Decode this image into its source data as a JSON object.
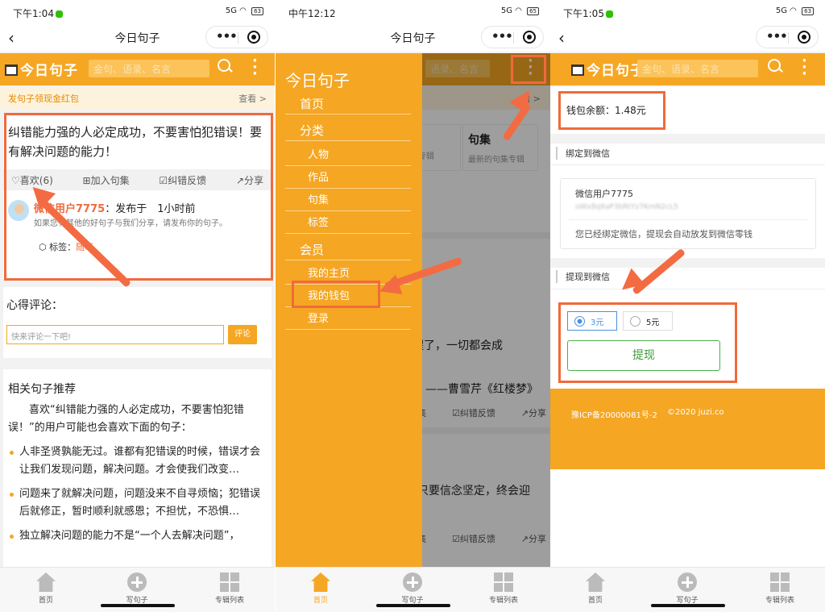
{
  "status": {
    "p1_time": "下午1:04",
    "p2_time": "中午12:12",
    "p3_time": "下午1:05",
    "signal": "5G",
    "p1_battery": "63",
    "p2_battery": "65",
    "p3_battery": "63"
  },
  "app": {
    "title": "今日句子",
    "logo": "今日句子",
    "search_placeholder": "金句、语录、名言",
    "brand_color": "#f5a623",
    "annotation_color": "#f06a3c"
  },
  "p1": {
    "promo": "发句子领现金红包",
    "promo_more": "查看 >",
    "sentence": "纠错能力强的人必定成功，不要害怕犯错误！要有解决问题的能力！",
    "actions": [
      "♡喜欢(6)",
      "⊞加入句集",
      "☑纠错反馈",
      "↗分享"
    ],
    "author_name": "微信用户7775",
    "posted": "：发布于　1小时前",
    "invite": "如果您有其他的好句子与我们分享，请发布你的句子。",
    "tag_label": "标签：",
    "tag_value": "随笔",
    "comment_title": "心得评论：",
    "comment_placeholder": "快来评论一下吧!",
    "comment_button": "评论",
    "related_title": "相关句子推荐",
    "related_intro": "　　喜欢“纠错能力强的人必定成功，不要害怕犯错误！”的用户可能也会喜欢下面的句子：",
    "related": [
      "人非圣贤孰能无过。谁都有犯错误的时候，错误才会让我们发现问题，解决问题。才会使我们改变…",
      "问题来了就解决问题，问题没来不自寻烦恼；犯错误后就修正，暂时顺利就感恩；不担忧，不恐惧…",
      "独立解决问题的能力不是“一个人去解决问题”，"
    ]
  },
  "p2": {
    "drawer_title": "今日句子",
    "menu": [
      {
        "label": "首页",
        "kind": "sec"
      },
      {
        "label": "分类",
        "kind": "sec"
      },
      {
        "label": "人物",
        "kind": "sub"
      },
      {
        "label": "作品",
        "kind": "sub"
      },
      {
        "label": "句集",
        "kind": "sub"
      },
      {
        "label": "标签",
        "kind": "sub"
      },
      {
        "label": "会员",
        "kind": "sec"
      },
      {
        "label": "我的主页",
        "kind": "sub"
      },
      {
        "label": "我的钱包",
        "kind": "sub"
      },
      {
        "label": "登录",
        "kind": "sub"
      }
    ],
    "bg_more": "看 >",
    "bg_card_title": "句集",
    "bg_card_sub": "最新的句集专辑",
    "bg_card_left": "品专辑",
    "bg_quote1": "醒了，一切都会成",
    "bg_author1": "——曹雪芹《红楼梦》",
    "bg_actions": [
      "集",
      "☑纠错反馈",
      "↗分享"
    ],
    "bg_quote2": "只要信念坚定，终会迎",
    "bg_actions2": [
      "集",
      "☑纠错反馈",
      "↗分享"
    ]
  },
  "p3": {
    "balance": "钱包余额：1.48元",
    "bind_title": "绑定到微信",
    "wx_user": "微信用户7775",
    "wx_id": "oWx8q9aP3bRtYz7KmN2cL5",
    "wx_note": "您已经绑定微信，提现会自动放发到微信零钱",
    "withdraw_title": "提现到微信",
    "options": [
      "3元",
      "5元"
    ],
    "selected": "3元",
    "withdraw_button": "提现",
    "icp": "豫ICP备20000081号-2",
    "copyright": "©2020 juzi.co"
  },
  "tabbar": {
    "home": "首页",
    "write": "写句子",
    "albums": "专辑列表"
  }
}
